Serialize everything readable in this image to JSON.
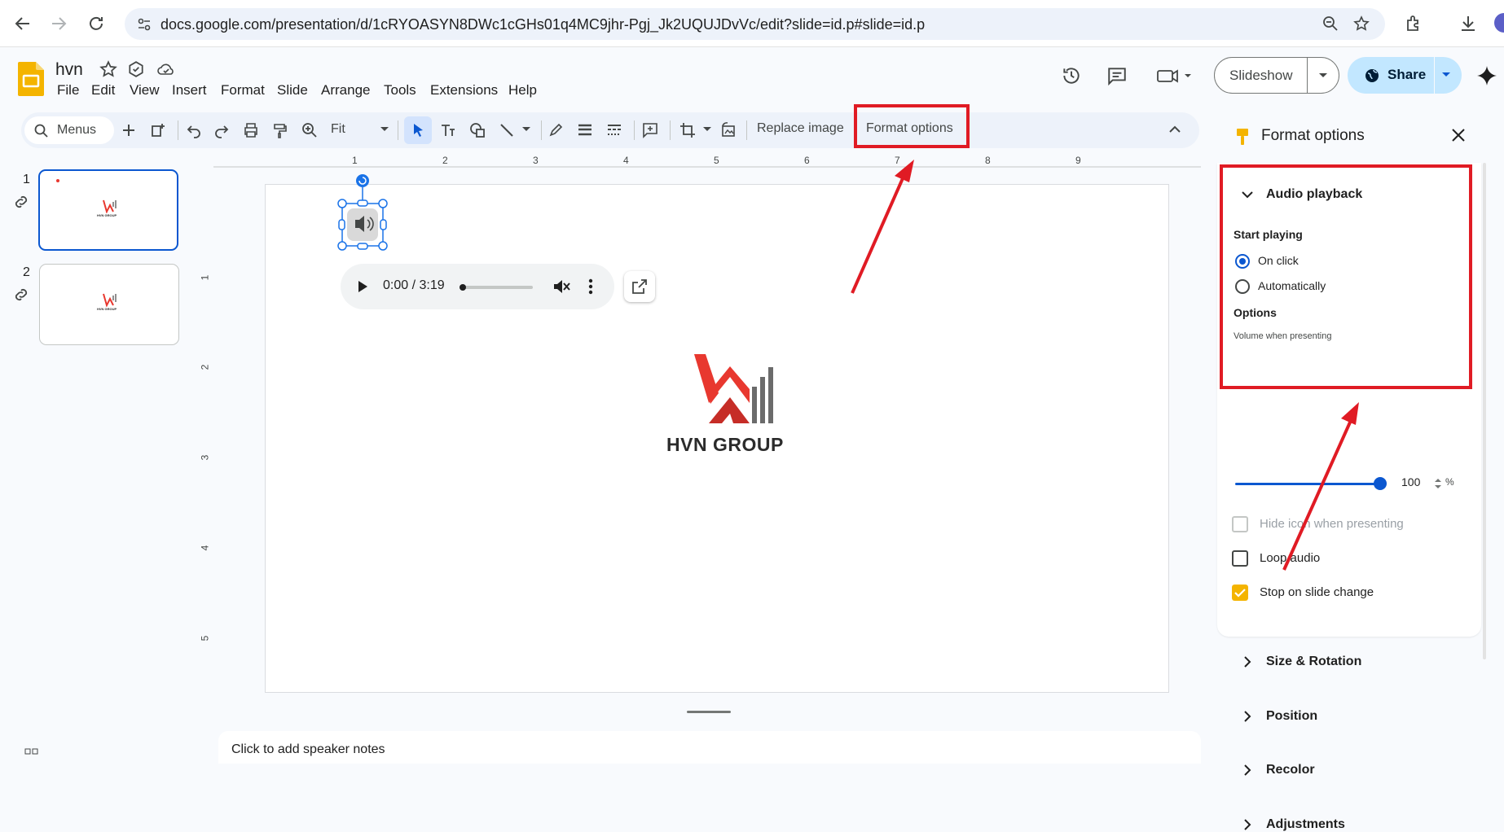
{
  "browser": {
    "url": "docs.google.com/presentation/d/1cRYOASYN8DWc1cGHs01q4MC9jhr-Pgj_Jk2UQUJDvVc/edit?slide=id.p#slide=id.p"
  },
  "doc": {
    "title": "hvn",
    "menu": [
      "File",
      "Edit",
      "View",
      "Insert",
      "Format",
      "Slide",
      "Arrange",
      "Tools",
      "Extensions",
      "Help"
    ],
    "slideshow_label": "Slideshow",
    "share_label": "Share"
  },
  "toolbar": {
    "search_label": "Menus",
    "zoom_label": "Fit",
    "replace_image_label": "Replace image",
    "format_options_label": "Format options"
  },
  "filmstrip": {
    "slides": [
      {
        "number": "1",
        "selected": true,
        "logo_text": "HVN GROUP"
      },
      {
        "number": "2",
        "selected": false,
        "logo_text": "HVN GROUP"
      }
    ]
  },
  "rulers": {
    "horizontal": [
      "1",
      "2",
      "3",
      "4",
      "5",
      "6",
      "7",
      "8",
      "9"
    ],
    "vertical": [
      "1",
      "2",
      "3",
      "4",
      "5"
    ]
  },
  "slide": {
    "audio_time": "0:00 / 3:19",
    "logo_text": "HVN GROUP",
    "logo_colors": {
      "red": "#e8382f",
      "gray": "#6b6b6b"
    }
  },
  "notes": {
    "placeholder": "Click to add speaker notes"
  },
  "panel": {
    "title": "Format options",
    "audio_section": "Audio playback",
    "start_playing_label": "Start playing",
    "on_click_label": "On click",
    "automatically_label": "Automatically",
    "start_playing_selected": "On click",
    "options_label": "Options",
    "volume_label": "Volume when presenting",
    "volume_value": "100",
    "volume_unit": "%",
    "volume_level": 1.0,
    "hide_icon_label": "Hide icon when presenting",
    "loop_audio_label": "Loop audio",
    "stop_on_slide_change_label": "Stop on slide change",
    "hide_icon_checked": false,
    "loop_audio_checked": false,
    "stop_on_slide_change_checked": true,
    "collapsed_sections": [
      "Size & Rotation",
      "Position",
      "Recolor",
      "Adjustments"
    ]
  },
  "colors": {
    "accent_blue": "#0b57d0",
    "annotation_red": "#e01b24",
    "checkbox_yellow": "#f4b400",
    "slides_yellow": "#f4b400"
  }
}
